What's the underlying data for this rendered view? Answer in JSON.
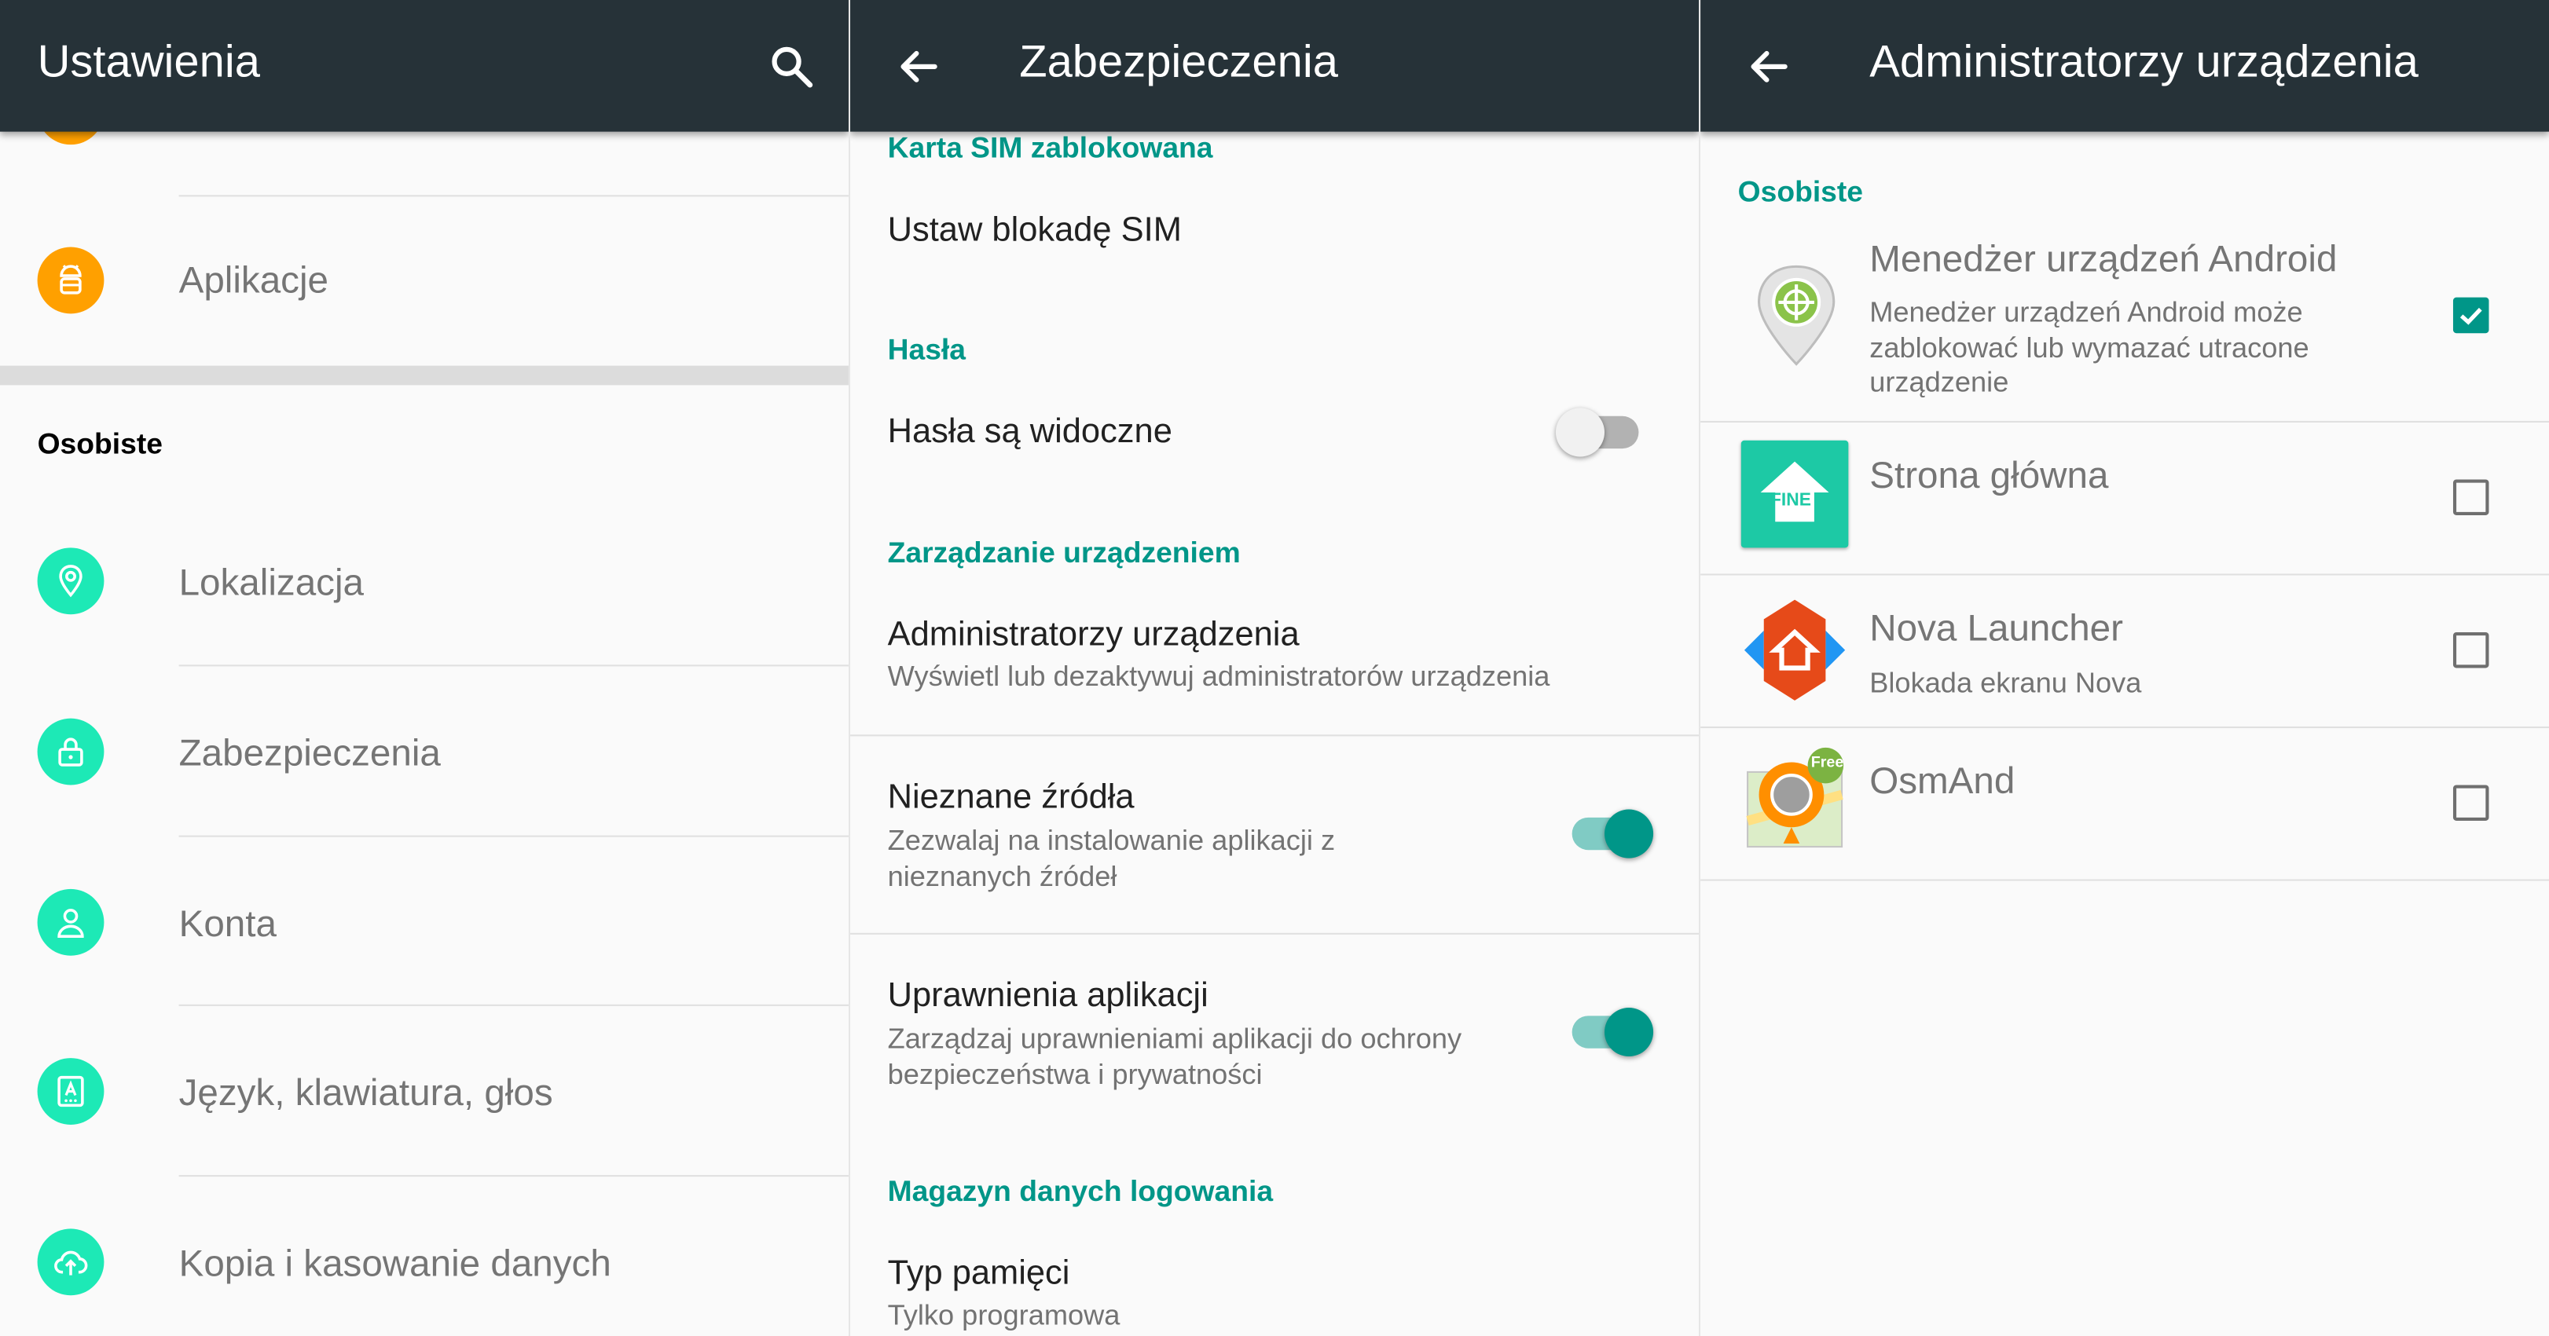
{
  "colors": {
    "toolbar": "#263238",
    "accent": "#009688",
    "personal_icon": "#1de9b6",
    "apps_icon": "#ffa000"
  },
  "settings": {
    "title": "Ustawienia",
    "search_icon": "search-icon",
    "apps_item": {
      "label": "Aplikacje",
      "icon": "android-icon"
    },
    "section_personal": "Osobiste",
    "items": [
      {
        "label": "Lokalizacja",
        "icon": "location-pin-icon"
      },
      {
        "label": "Zabezpieczenia",
        "icon": "lock-icon"
      },
      {
        "label": "Konta",
        "icon": "person-icon"
      },
      {
        "label": "Język, klawiatura, głos",
        "icon": "keyboard-icon"
      },
      {
        "label": "Kopia i kasowanie danych",
        "icon": "cloud-upload-icon"
      }
    ]
  },
  "security": {
    "title": "Zabezpieczenia",
    "back_icon": "back-arrow-icon",
    "sim_header": "Karta SIM zablokowana",
    "sim_lock": "Ustaw blokadę SIM",
    "passwords_header": "Hasła",
    "passwords_visible": {
      "title": "Hasła są widoczne",
      "checked": false
    },
    "device_mgmt_header": "Zarządzanie urządzeniem",
    "device_admins": {
      "title": "Administratorzy urządzenia",
      "subtitle": "Wyświetl lub dezaktywuj administratorów urządzenia"
    },
    "unknown_sources": {
      "title": "Nieznane źródła",
      "subtitle": "Zezwalaj na instalowanie aplikacji z nieznanych źródeł",
      "checked": true
    },
    "app_permissions": {
      "title": "Uprawnienia aplikacji",
      "subtitle": "Zarządzaj uprawnieniami aplikacji do ochrony bezpieczeństwa i prywatności",
      "checked": true
    },
    "credentials_header": "Magazyn danych logowania",
    "storage_type": {
      "title": "Typ pamięci",
      "subtitle": "Tylko programowa"
    }
  },
  "admins": {
    "title": "Administratorzy urządzenia",
    "back_icon": "back-arrow-icon",
    "section": "Osobiste",
    "apps": [
      {
        "name": "Menedżer urządzeń Android",
        "description": "Menedżer urządzeń Android może zablokować lub wymazać utracone urządzenie",
        "checked": true,
        "icon": "android-device-manager-icon"
      },
      {
        "name": "Strona główna",
        "description": "",
        "checked": false,
        "icon": "fine-home-icon",
        "icon_text": "FINE"
      },
      {
        "name": "Nova Launcher",
        "description": "Blokada ekranu Nova",
        "checked": false,
        "icon": "nova-launcher-icon"
      },
      {
        "name": "OsmAnd",
        "description": "",
        "checked": false,
        "icon": "osmand-icon",
        "badge": "Free"
      }
    ]
  }
}
